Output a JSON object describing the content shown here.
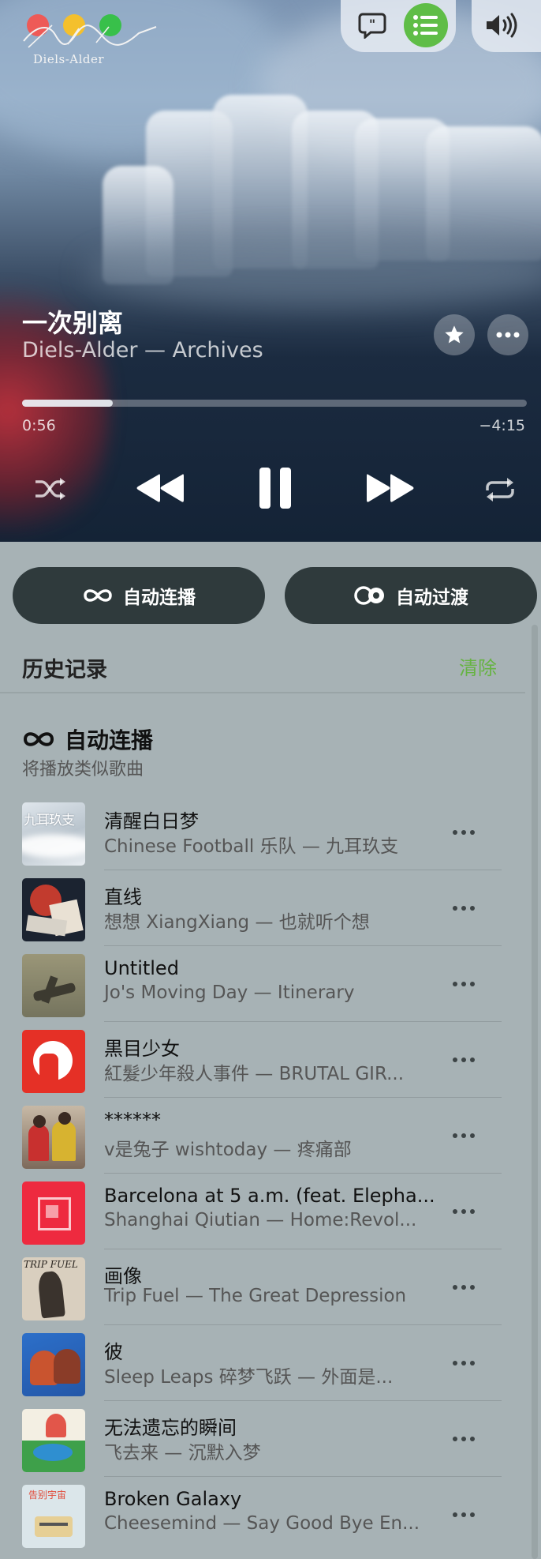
{
  "window": {
    "controls": {
      "close_color": "#ee5a57",
      "minimize_color": "#f4c02d",
      "maximize_color": "#38c04a"
    }
  },
  "album_art": {
    "artist_mark": "Diels-Alder"
  },
  "toolbar": {
    "lyrics_icon": "lyrics-bubble-icon",
    "queue_icon": "list-icon",
    "queue_active_color": "#5fbd47",
    "volume_icon": "speaker-icon"
  },
  "now_playing": {
    "title": "一次别离",
    "subtitle": "Diels-Alder — Archives",
    "elapsed": "0:56",
    "remaining": "−4:15",
    "progress": 0.18,
    "favorite_icon": "star-icon",
    "more_icon": "ellipsis-icon"
  },
  "controls": {
    "shuffle_icon": "shuffle-icon",
    "previous_icon": "backward-icon",
    "pause_icon": "pause-icon",
    "next_icon": "forward-icon",
    "repeat_icon": "repeat-icon"
  },
  "modes": {
    "autoplay_label": "自动连播",
    "crossfade_label": "自动过渡"
  },
  "history": {
    "title": "历史记录",
    "clear_label": "清除"
  },
  "autoplay": {
    "title": "自动连播",
    "subtitle": "将播放类似歌曲"
  },
  "queue": [
    {
      "title": "清醒白日梦",
      "subtitle": "Chinese Football 乐队 — 九耳玖支",
      "art_text": "九耳玖支"
    },
    {
      "title": "直线",
      "subtitle": "想想 XiangXiang — 也就听个想"
    },
    {
      "title": "Untitled",
      "subtitle": "Jo's Moving Day — Itinerary"
    },
    {
      "title": "黒目少女",
      "subtitle": "紅髮少年殺人事件 — BRUTAL GIR..."
    },
    {
      "title": "******",
      "subtitle": "v是兔子 wishtoday — 疼痛部"
    },
    {
      "title": "Barcelona at 5 a.m. (feat. Elepha...",
      "subtitle": "Shanghai Qiutian — Home:Revol..."
    },
    {
      "title": "画像",
      "subtitle": "Trip Fuel — The Great Depression",
      "art_text": "TRIP FUEL"
    },
    {
      "title": "彼",
      "subtitle": "Sleep Leaps 碎梦飞跃 — 外面是..."
    },
    {
      "title": "无法遗忘的瞬间",
      "subtitle": "飞去来 — 沉默入梦"
    },
    {
      "title": "Broken Galaxy",
      "subtitle": "Cheesemind — Say Good Bye En...",
      "art_text": "告别宇宙"
    }
  ]
}
